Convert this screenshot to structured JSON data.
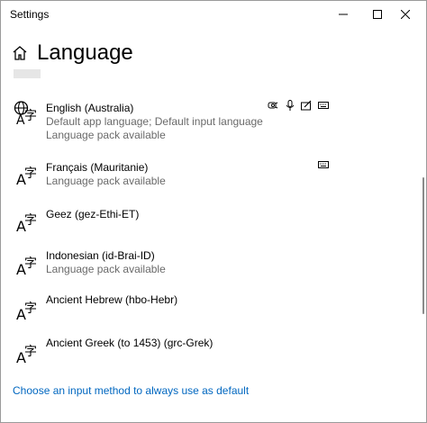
{
  "window": {
    "title": "Settings"
  },
  "header": {
    "title": "Language"
  },
  "languages": [
    {
      "name": "English (Australia)",
      "line1": "Default app language; Default input language",
      "line2": "Language pack available",
      "features": [
        "text-to-speech-icon",
        "speech-recognition-icon",
        "handwriting-icon",
        "keyboard-icon"
      ]
    },
    {
      "name": "Français (Mauritanie)",
      "line1": "Language pack available",
      "line2": "",
      "features": [
        "keyboard-icon"
      ]
    },
    {
      "name": "Geez (gez-Ethi-ET)",
      "line1": "",
      "line2": "",
      "features": []
    },
    {
      "name": "Indonesian (id-Brai-ID)",
      "line1": "Language pack available",
      "line2": "",
      "features": []
    },
    {
      "name": "Ancient Hebrew (hbo-Hebr)",
      "line1": "",
      "line2": "",
      "features": []
    },
    {
      "name": "Ancient Greek (to 1453) (grc-Grek)",
      "line1": "",
      "line2": "",
      "features": []
    }
  ],
  "link": {
    "text": "Choose an input method to always use as default"
  },
  "icons": {
    "language": "language-icon",
    "home": "home-icon"
  },
  "colors": {
    "link": "#0067c0",
    "secondary_text": "#6a6a6a"
  }
}
